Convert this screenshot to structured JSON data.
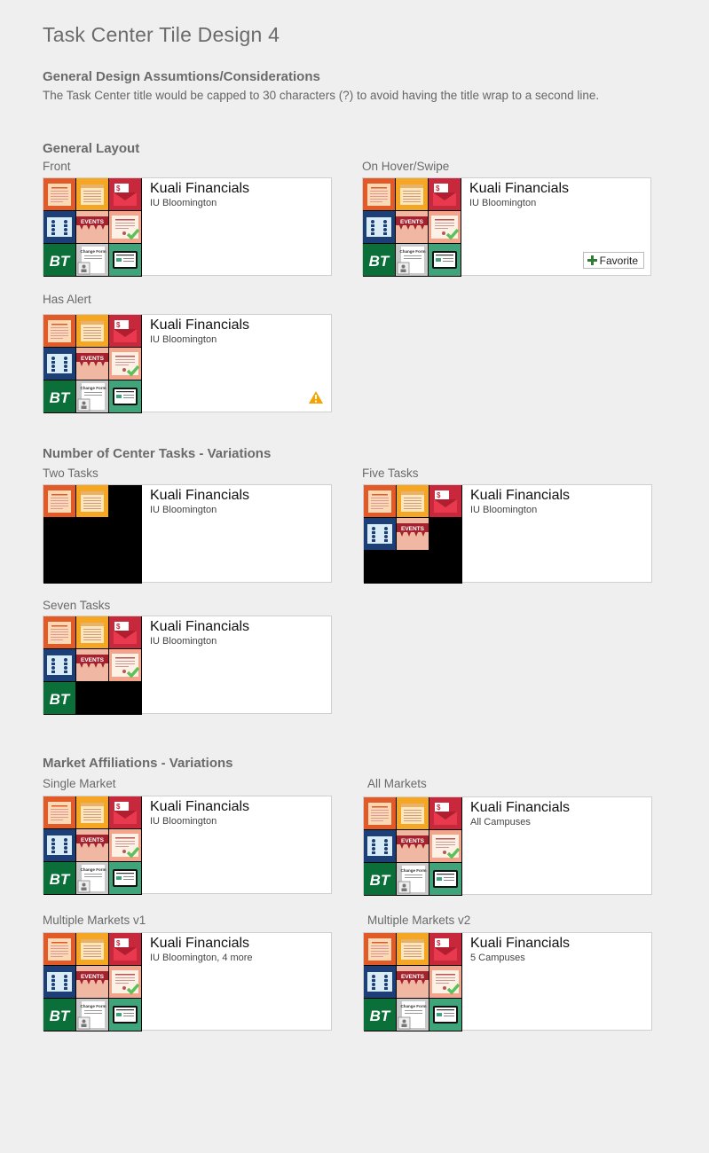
{
  "page": {
    "title": "Task Center Tile Design 4",
    "assumptions_heading": "General Design Assumtions/Considerations",
    "assumptions_text": "The Task Center title would be capped to 30 characters (?) to avoid having the title wrap to a second line."
  },
  "sections": {
    "general_layout": {
      "heading": "General Layout",
      "front_label": "Front",
      "hover_label": "On Hover/Swipe",
      "alert_label": "Has Alert"
    },
    "variations": {
      "heading": "Number of Center Tasks - Variations",
      "two_label": "Two Tasks",
      "five_label": "Five Tasks",
      "seven_label": "Seven Tasks"
    },
    "markets": {
      "heading": "Market Affiliations - Variations",
      "single_label": "Single Market",
      "all_label": "All Markets",
      "multi1_label": "Multiple Markets v1",
      "multi2_label": "Multiple Markets v2"
    }
  },
  "tile": {
    "name": "Kuali Financials",
    "campus": "IU Bloomington",
    "favorite_label": "Favorite",
    "all_campuses": "All Campuses",
    "multi_v1": "IU Bloomington, 4 more",
    "multi_v2": "5 Campuses"
  },
  "task_icons": [
    "document-icon",
    "notes-icon",
    "mail-icon",
    "people-icon",
    "events-icon",
    "certificate-icon",
    "bt-logo-icon",
    "change-form-icon",
    "card-icon"
  ],
  "colors": {
    "orange": "#e15a28",
    "yellow": "#f5a623",
    "red": "#c8283c",
    "navy": "#1d3f78",
    "pink": "#f0b7a2",
    "salmon": "#f4a48a",
    "green": "#0b6f3a",
    "teal": "#3fa47a",
    "gray": "#c9c9c9",
    "alert": "#f5a300"
  }
}
